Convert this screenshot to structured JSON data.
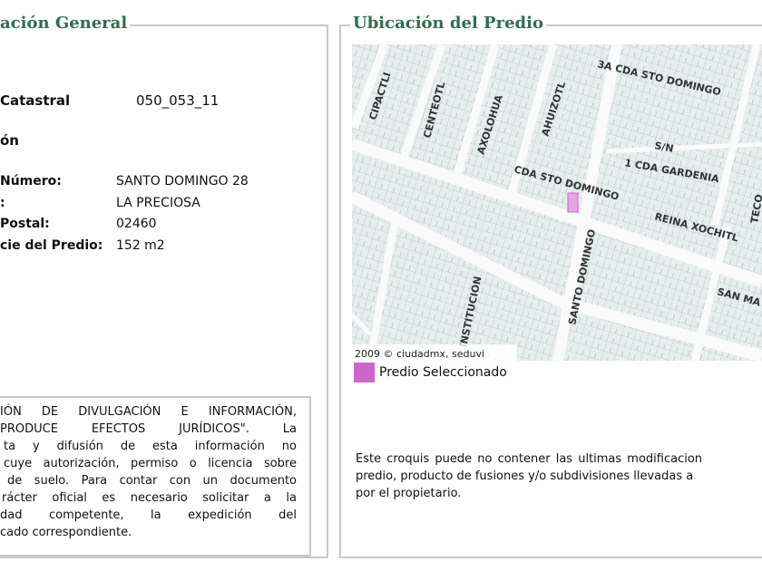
{
  "general": {
    "legend": "ación General",
    "cuenta_label": "Catastral",
    "cuenta_value": "050_053_11",
    "ubicacion_heading": "ón",
    "rows": [
      {
        "label": "Número:",
        "value": "SANTO DOMINGO 28"
      },
      {
        "label": ":",
        "value": "LA PRECIOSA"
      },
      {
        "label": "Postal:",
        "value": "02460"
      },
      {
        "label": "cie del Predio:",
        "value": "152 m2"
      }
    ],
    "disclaimer_lines": [
      "IÓN DE DIVULGACIÓN E INFORMACIÓN,",
      "PRODUCE EFECTOS JURÍDICOS\". La",
      "ta y difusión de esta información no",
      "cuye autorización, permiso o licencia sobre",
      "de suelo. Para contar con un documento",
      "rácter oficial es necesario solicitar a la",
      "dad competente, la expedición del",
      "cado correspondiente."
    ]
  },
  "predio": {
    "legend": "Ubicación del Predio",
    "map": {
      "streets": [
        "CIPACTLI",
        "CENTEOTL",
        "AXOLOHUA",
        "AHUIZOTL",
        "3A CDA STO DOMINGO",
        "S/N",
        "1 CDA GARDENIA",
        "CDA STO DOMINGO",
        "REINA XOCHITL",
        "TECO",
        "SANTO DOMINGO",
        "INSTITUCION",
        "SAN MA"
      ],
      "copyright": "2009 © ciudadmx, seduvi",
      "highlight_color": "#cc66cc"
    },
    "legend_item": "Predio Seleccionado",
    "note_lines": [
      "Este croquis puede no contener las ultimas modificacion",
      "predio, producto de fusiones y/o subdivisiones llevadas a",
      "por el propietario."
    ]
  }
}
